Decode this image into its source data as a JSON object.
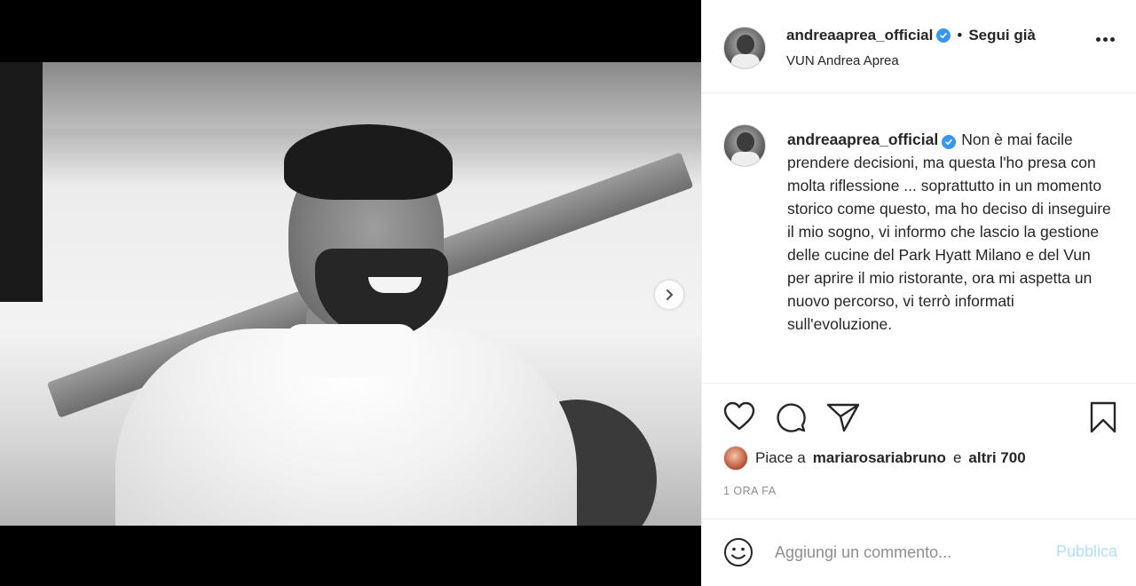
{
  "post": {
    "username": "andreaaprea_official",
    "follow_status": "Segui già",
    "separator": "•",
    "location": "VUN Andrea Aprea"
  },
  "caption": {
    "username": "andreaaprea_official",
    "text": "Non è mai facile prendere decisioni, ma questa l'ho presa con molta riflessione ... soprattutto in un momento storico come questo, ma ho deciso di inseguire il mio sogno, vi informo che lascio la gestione delle cucine del Park Hyatt Milano e del Vun per aprire il mio ristorante, ora mi aspetta un nuovo percorso, vi terrò informati sull'evoluzione."
  },
  "likes": {
    "prefix": "Piace a",
    "liker": "mariarosariabruno",
    "joiner": "e",
    "others": "altri 700"
  },
  "time": "1 ORA FA",
  "comment": {
    "placeholder": "Aggiungi un commento...",
    "publish_label": "Pubblica"
  },
  "icons": {
    "like": "heart-icon",
    "comment": "comment-icon",
    "share": "send-icon",
    "save": "bookmark-icon",
    "emoji": "smiley-icon",
    "more": "more-horizontal-icon",
    "next": "chevron-right-icon",
    "verified": "verified-badge-icon"
  },
  "colors": {
    "verified": "#3897f0",
    "publish_disabled": "#b2dffc",
    "meta_gray": "#8e8e8e",
    "text": "#262626"
  }
}
